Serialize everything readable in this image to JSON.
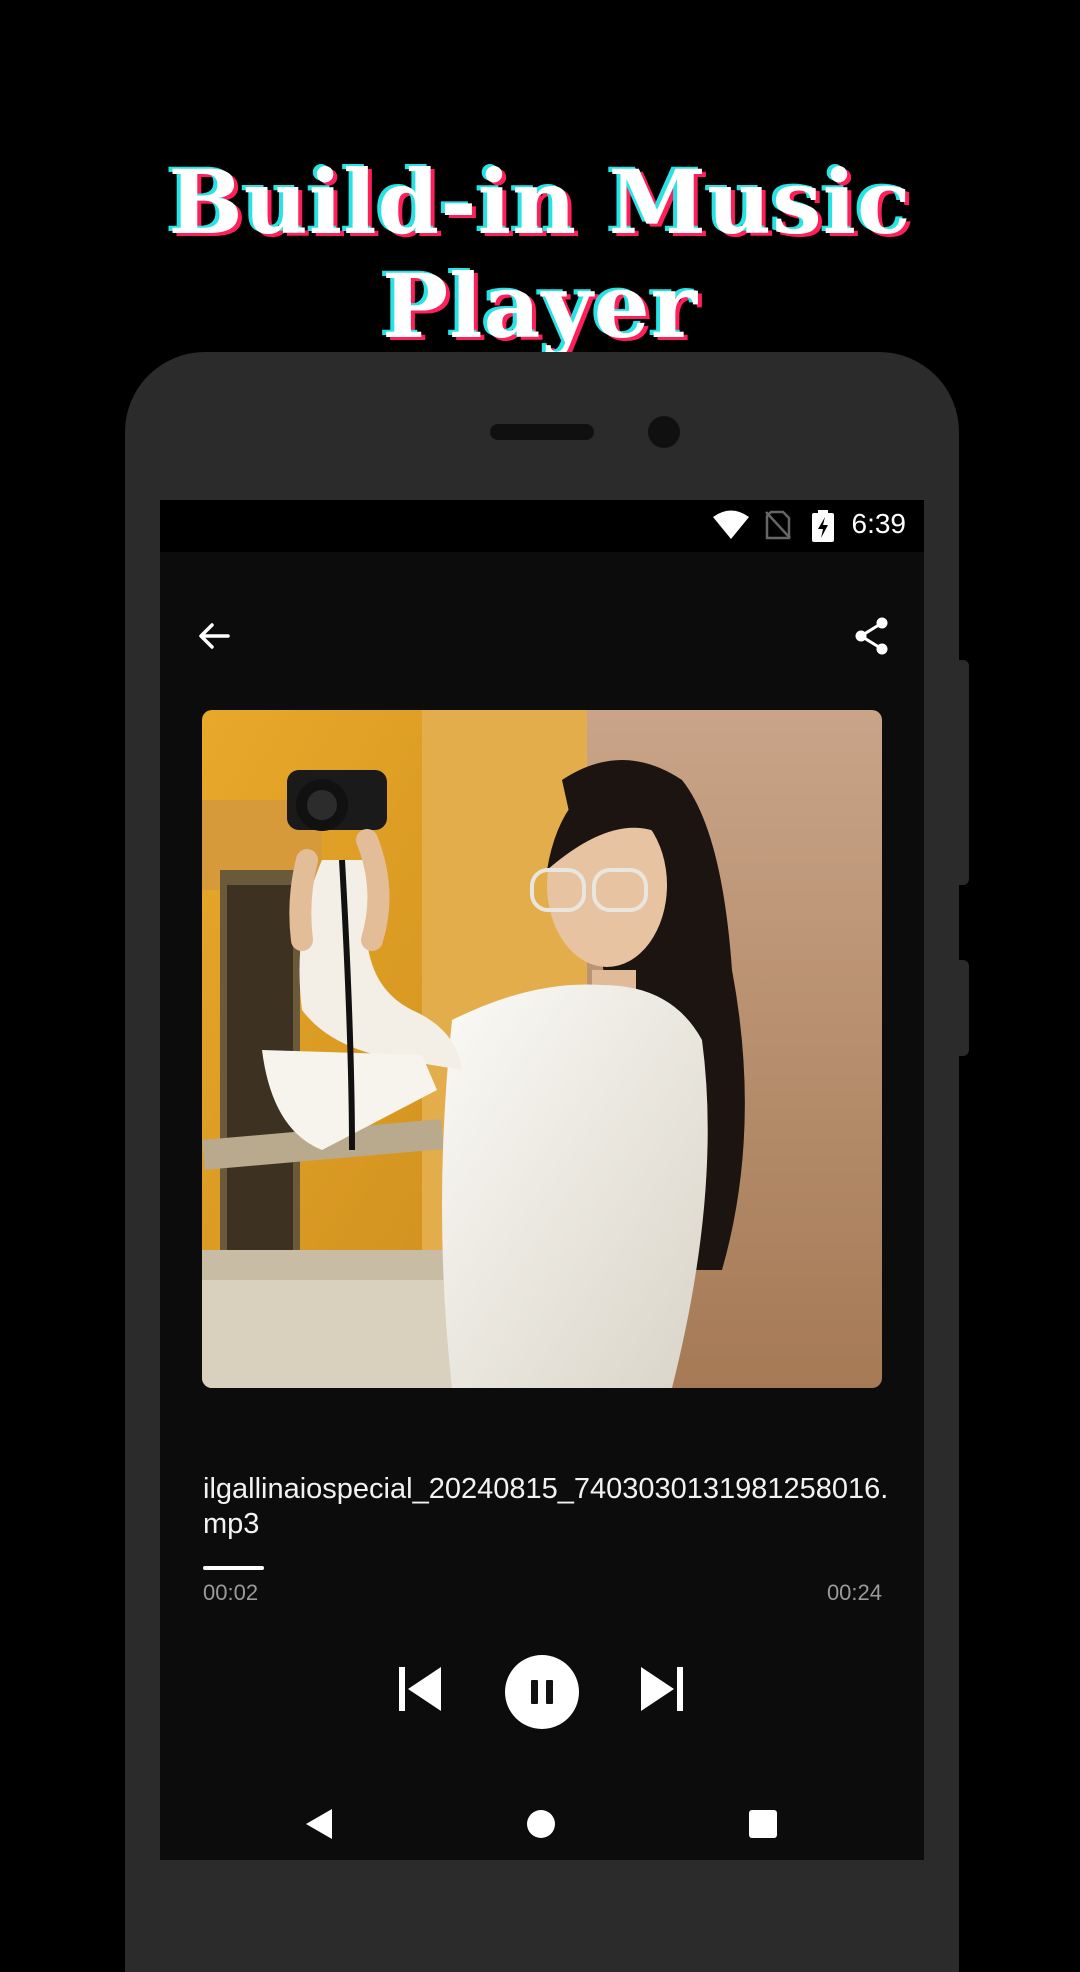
{
  "promo": {
    "headline": "Build-in Music Player"
  },
  "status_bar": {
    "time": "6:39",
    "icons": [
      "wifi-icon",
      "no-sim-icon",
      "battery-charging-icon"
    ]
  },
  "app_bar": {
    "back_icon": "arrow-back-icon",
    "share_icon": "share-icon"
  },
  "player": {
    "artwork_description_icon": "album-artwork",
    "title": "ilgallinaiospecial_20240815_7403030131981258016.mp3",
    "current_time": "00:02",
    "total_time": "00:24",
    "progress_fraction": 0.09,
    "controls": [
      "skip-previous-icon",
      "pause-icon",
      "skip-next-icon"
    ]
  },
  "nav_bar": {
    "buttons": [
      "nav-back-icon",
      "nav-home-icon",
      "nav-recents-icon"
    ]
  },
  "colors": {
    "background": "#000000",
    "screen": "#0c0c0c",
    "phone_frame": "#2b2b2b",
    "headline_cyan": "#28e3e6",
    "headline_pink": "#ff1f5a"
  }
}
